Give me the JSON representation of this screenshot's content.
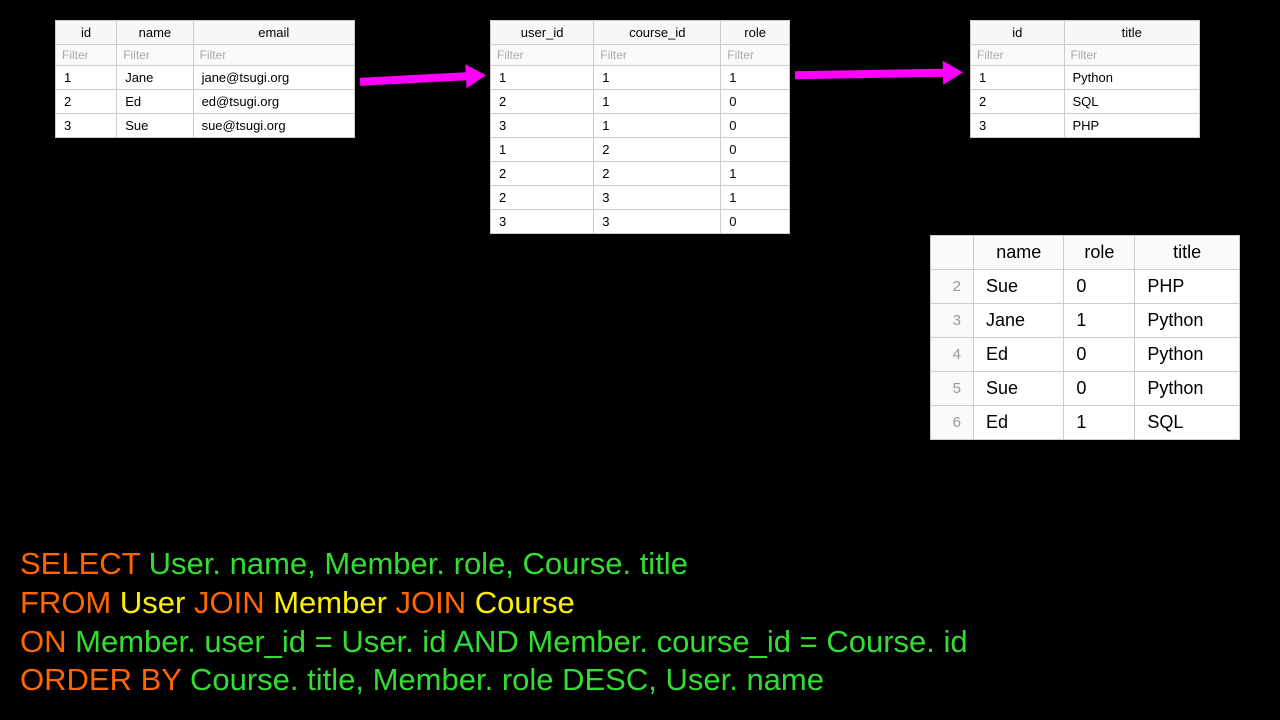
{
  "filter_placeholder": "Filter",
  "tables": {
    "user": {
      "headers": [
        "id",
        "name",
        "email"
      ],
      "rows": [
        [
          "1",
          "Jane",
          "jane@tsugi.org"
        ],
        [
          "2",
          "Ed",
          "ed@tsugi.org"
        ],
        [
          "3",
          "Sue",
          "sue@tsugi.org"
        ]
      ]
    },
    "member": {
      "headers": [
        "user_id",
        "course_id",
        "role"
      ],
      "rows": [
        [
          "1",
          "1",
          "1"
        ],
        [
          "2",
          "1",
          "0"
        ],
        [
          "3",
          "1",
          "0"
        ],
        [
          "1",
          "2",
          "0"
        ],
        [
          "2",
          "2",
          "1"
        ],
        [
          "2",
          "3",
          "1"
        ],
        [
          "3",
          "3",
          "0"
        ]
      ]
    },
    "course": {
      "headers": [
        "id",
        "title"
      ],
      "rows": [
        [
          "1",
          "Python"
        ],
        [
          "2",
          "SQL"
        ],
        [
          "3",
          "PHP"
        ]
      ]
    }
  },
  "result": {
    "headers": [
      "",
      "name",
      "role",
      "title"
    ],
    "rows": [
      [
        "2",
        "Sue",
        "0",
        "PHP"
      ],
      [
        "3",
        "Jane",
        "1",
        "Python"
      ],
      [
        "4",
        "Ed",
        "0",
        "Python"
      ],
      [
        "5",
        "Sue",
        "0",
        "Python"
      ],
      [
        "6",
        "Ed",
        "1",
        "SQL"
      ]
    ]
  },
  "sql": {
    "select_kw": "SELECT",
    "select_fields": "User. name, Member. role, Course. title",
    "from_kw": "FROM",
    "t1": "User",
    "join1": "JOIN",
    "t2": "Member",
    "join2": "JOIN",
    "t3": "Course",
    "on_kw": "ON",
    "on_clause": "Member. user_id = User. id AND Member. course_id = Course. id",
    "order_kw": "ORDER BY",
    "order_clause": "Course. title, Member. role DESC, User. name"
  }
}
